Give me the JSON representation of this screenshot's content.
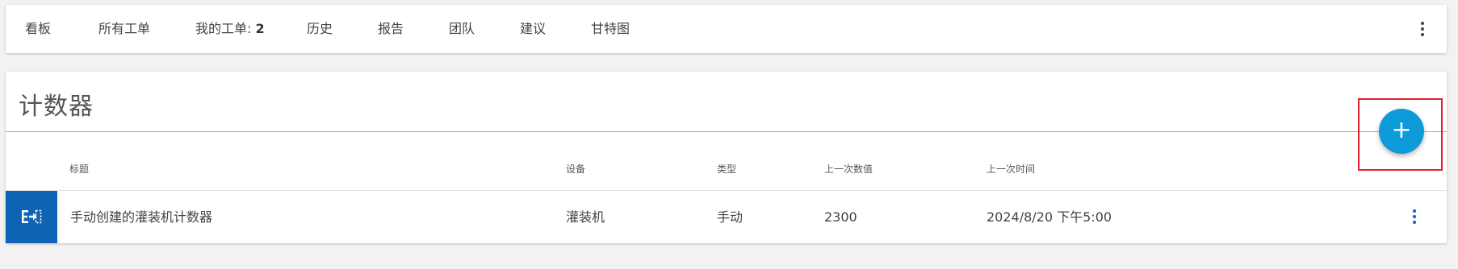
{
  "nav": {
    "tabs": [
      {
        "label": "看板"
      },
      {
        "label": "所有工单"
      },
      {
        "label": "我的工单: ",
        "count": "2"
      },
      {
        "label": "历史"
      },
      {
        "label": "报告"
      },
      {
        "label": "团队"
      },
      {
        "label": "建议"
      },
      {
        "label": "甘特图"
      }
    ],
    "more_icon": "more-vertical-icon"
  },
  "counters": {
    "title": "计数器",
    "columns": {
      "title": "标题",
      "equipment": "设备",
      "type": "类型",
      "last_value": "上一次数值",
      "last_time": "上一次时间"
    },
    "rows": [
      {
        "icon": "counter-input-icon",
        "title": "手动创建的灌装机计数器",
        "equipment": "灌装机",
        "type": "手动",
        "last_value": "2300",
        "last_time": "2024/8/20 下午5:00"
      }
    ],
    "add_button": {
      "label": "+",
      "icon": "add-icon"
    }
  },
  "colors": {
    "accent": "#0d9ad9",
    "row_icon_bg": "#0e63b4",
    "highlight": "#e0202a"
  }
}
